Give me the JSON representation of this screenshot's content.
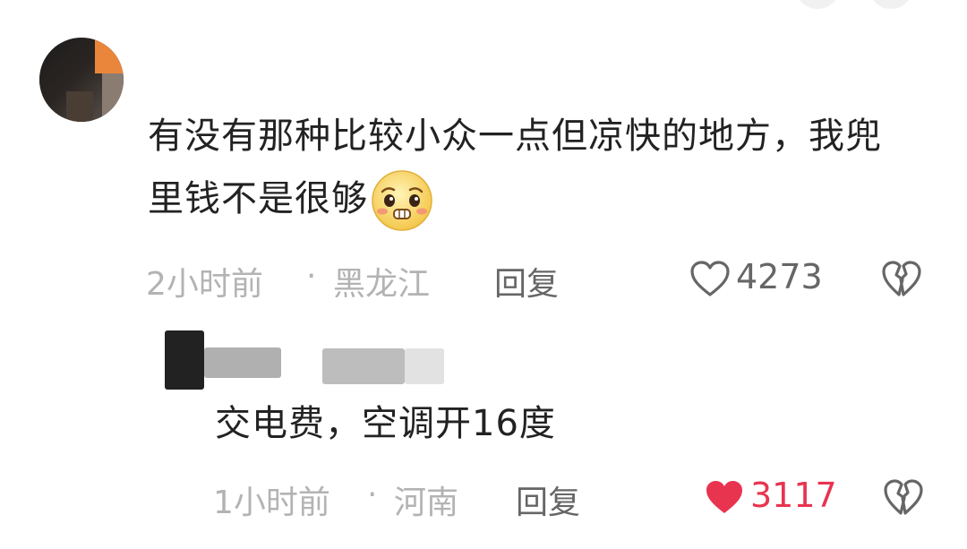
{
  "comment": {
    "text": "有没有那种比较小众一点但凉快的地方，我兜里钱不是很够",
    "emoji_icon": "worried-face-emoji-icon",
    "time": "2小时前",
    "separator": "·",
    "location": "黑龙江",
    "reply_label": "回复",
    "like_count": "4273",
    "like_icon": "heart-outline-icon",
    "dislike_icon": "broken-heart-icon"
  },
  "reply": {
    "text": "交电费，空调开16度",
    "time": "1小时前",
    "separator": "·",
    "location": "河南",
    "reply_label": "回复",
    "like_count": "3117",
    "liked": true,
    "like_icon": "heart-filled-icon",
    "dislike_icon": "broken-heart-icon"
  },
  "colors": {
    "text": "#222222",
    "meta": "#b3b3b3",
    "action": "#666666",
    "liked": "#e8344f"
  }
}
